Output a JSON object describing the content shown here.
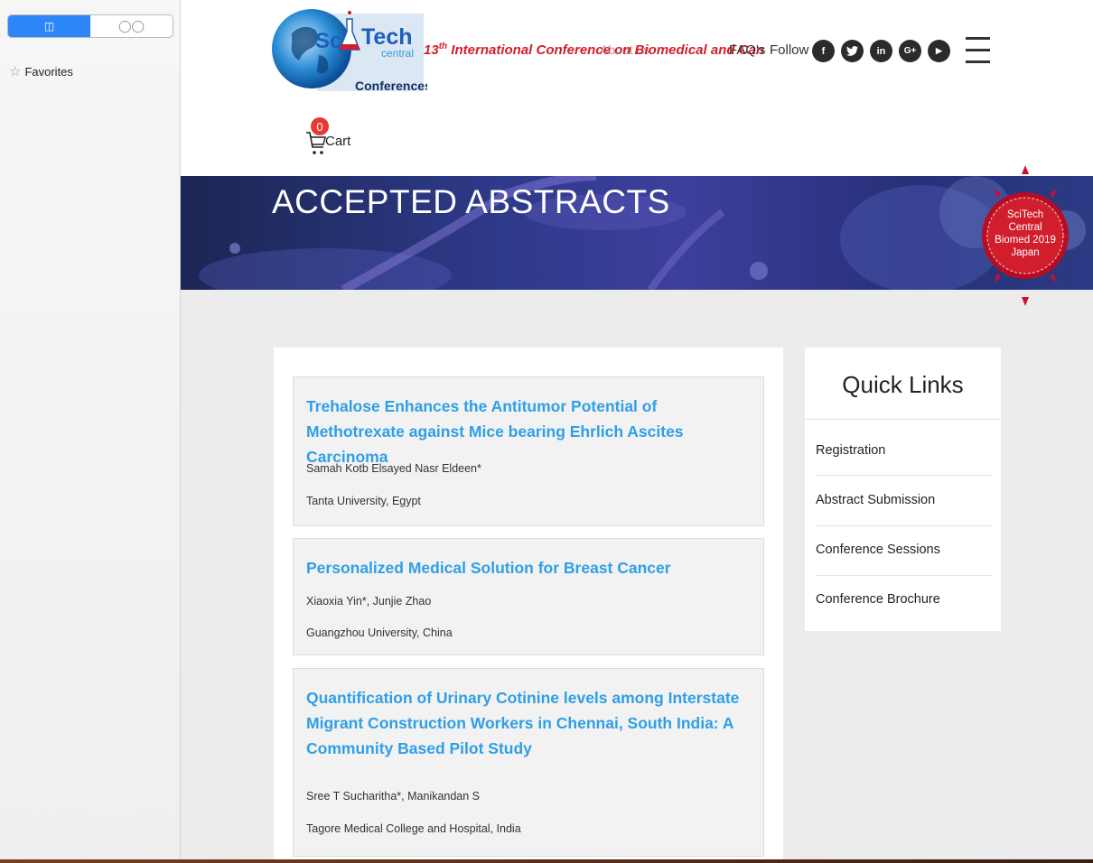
{
  "sidebar": {
    "tabs": [
      {
        "icon": "book-icon",
        "glyph": "📖"
      },
      {
        "icon": "reading-glasses-icon",
        "glyph": "◯◯"
      }
    ],
    "favorites_label": "Favorites"
  },
  "header": {
    "logo": {
      "sc": "Sc",
      "tech": "Tech",
      "central": "central",
      "conferences": "Conferences"
    },
    "conference_title_prefix": "13",
    "conference_title_sup": "th",
    "conference_title_rest": " International Conference on Biomedical and Can",
    "overlap_text": "About us",
    "faqs": "FAQ's",
    "follow": "Follow",
    "social": [
      {
        "name": "facebook-icon",
        "glyph": "f"
      },
      {
        "name": "twitter-icon",
        "glyph": "🐦"
      },
      {
        "name": "linkedin-icon",
        "glyph": "in"
      },
      {
        "name": "google-plus-icon",
        "glyph": "G+"
      },
      {
        "name": "youtube-icon",
        "glyph": "▶"
      }
    ],
    "cart_count": "0",
    "cart_label": "Cart"
  },
  "banner": {
    "title": "ACCEPTED ABSTRACTS",
    "badge_lines": [
      "SciTech",
      "Central",
      "Biomed 2019",
      "Japan"
    ]
  },
  "abstracts": [
    {
      "title": "Trehalose Enhances the Antitumor Potential of Methotrexate against Mice bearing Ehrlich Ascites Carcinoma",
      "authors": "Samah Kotb Elsayed Nasr Eldeen*",
      "affiliation": "Tanta University, Egypt"
    },
    {
      "title": "Personalized Medical Solution for Breast Cancer",
      "authors": "Xiaoxia Yin*, Junjie Zhao",
      "affiliation": "Guangzhou University, China"
    },
    {
      "title": "Quantification of Urinary Cotinine levels among Interstate Migrant Construction Workers in Chennai, South India: A Community Based Pilot Study",
      "authors": "Sree T Sucharitha*, Manikandan S",
      "affiliation": "Tagore Medical College and Hospital, India"
    }
  ],
  "quick_links": {
    "title": "Quick Links",
    "items": [
      "Registration",
      "Abstract Submission",
      "Conference Sessions",
      "Conference Brochure"
    ]
  },
  "colors": {
    "accent_blue": "#2f9fe6",
    "title_red": "#d01e2c",
    "badge_red": "#c8102e"
  }
}
